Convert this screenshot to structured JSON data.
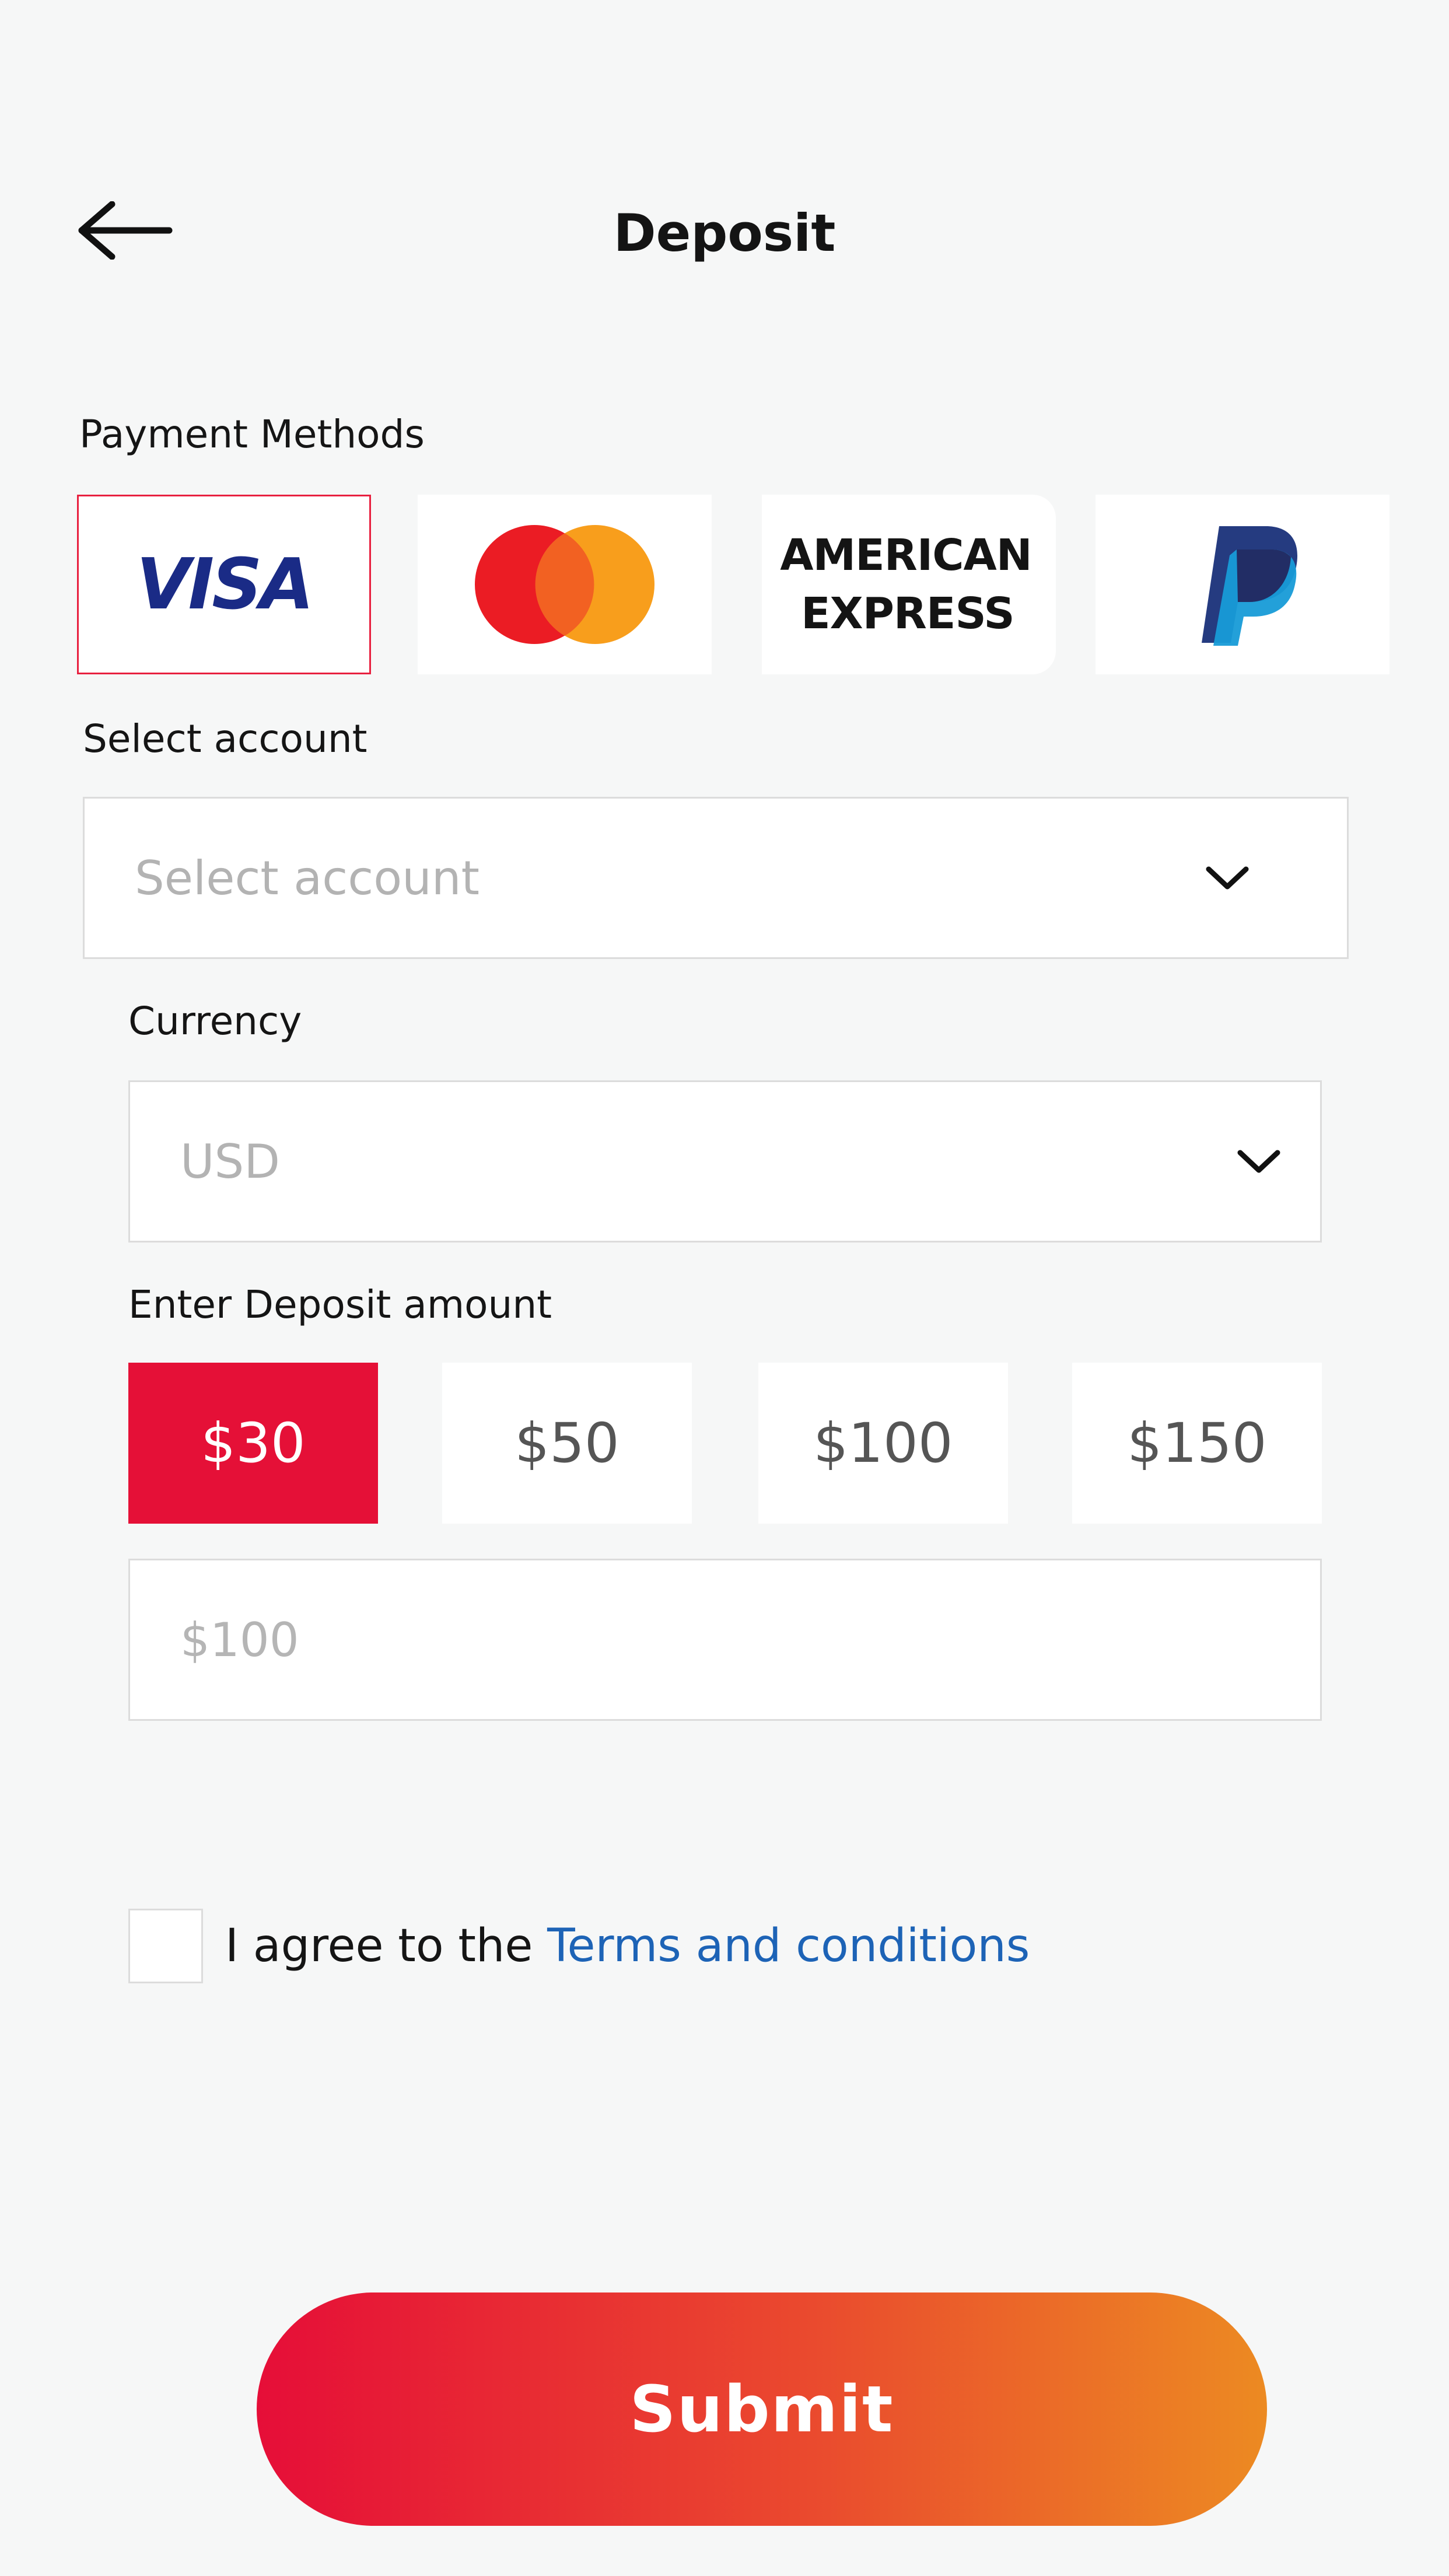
{
  "header": {
    "title": "Deposit",
    "back_icon": "arrow-left-icon"
  },
  "payment": {
    "label": "Payment Methods",
    "methods": [
      {
        "id": "visa",
        "label": "VISA",
        "selected": true
      },
      {
        "id": "mastercard",
        "label": "",
        "selected": false
      },
      {
        "id": "amex",
        "label_line1": "AMERICAN",
        "label_line2": "EXPRESS",
        "selected": false
      },
      {
        "id": "paypal",
        "label": "",
        "selected": false
      }
    ],
    "selected_border_color": "#e8203f"
  },
  "account": {
    "label": "Select account",
    "placeholder": "Select account"
  },
  "currency": {
    "label": "Currency",
    "value": "USD"
  },
  "amount": {
    "label": "Enter Deposit amount",
    "presets": [
      "$30",
      "$50",
      "$100",
      "$150"
    ],
    "active_index": 0,
    "input_placeholder": "$100"
  },
  "terms": {
    "prefix": "I agree to the ",
    "link": "Terms and conditions",
    "checked": false
  },
  "submit": {
    "label": "Submit"
  },
  "colors": {
    "accent": "#e51037",
    "link": "#1d63b6",
    "background": "#f6f7f7"
  }
}
